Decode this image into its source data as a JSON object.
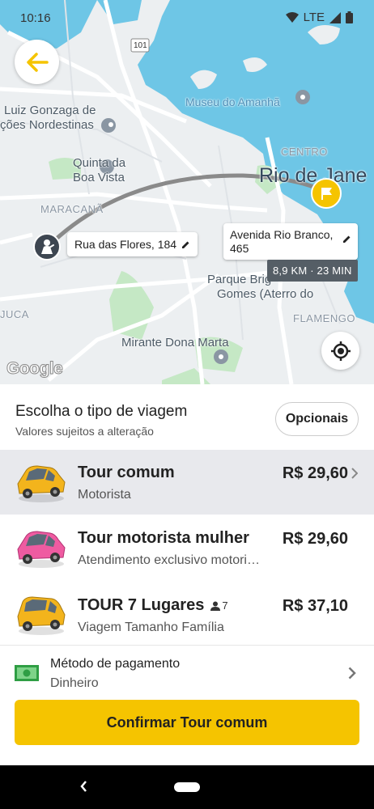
{
  "status_bar": {
    "time": "10:16",
    "network": "LTE"
  },
  "map": {
    "labels": {
      "luiz_gonzaga_1": "Luiz Gonzaga de",
      "luiz_gonzaga_2": "ções Nordestinas",
      "quinta_1": "Quinta da",
      "quinta_2": "Boa Vista",
      "maracana": "MARACANÃ",
      "museu": "Museu do Amanhã",
      "centro": "CENTRO",
      "rio": "Rio de Jane",
      "parque_1": "Parque Brig",
      "parque_2": "Gomes (Aterro do",
      "flamengo": "FLAMENGO",
      "mirante": "Mirante Dona Marta",
      "juca": "JUCA",
      "highway": "101"
    },
    "origin": {
      "address": "Rua das Flores, 184"
    },
    "destination": {
      "address": "Avenida Rio Branco, 465"
    },
    "eta": "8,9 KM · 23 MIN",
    "attribution": "Google"
  },
  "sheet": {
    "title": "Escolha o tipo de viagem",
    "subtitle": "Valores sujeitos a alteração",
    "optionals_label": "Opcionais",
    "rides": [
      {
        "name": "Tour comum",
        "description": "Motorista",
        "price": "R$ 29,60",
        "selected": true,
        "car_color": "#f3b41c"
      },
      {
        "name": "Tour motorista mulher",
        "description": "Atendimento exclusivo motori…",
        "price": "R$ 29,60",
        "selected": false,
        "car_color": "#ef5ba1"
      },
      {
        "name": "TOUR 7 Lugares",
        "seats": "7",
        "description": "Viagem Tamanho Família",
        "price": "R$ 37,10",
        "selected": false,
        "car_color": "#f3b41c"
      }
    ],
    "payment": {
      "label": "Método de pagamento",
      "value": "Dinheiro"
    },
    "confirm_label": "Confirmar Tour comum"
  },
  "colors": {
    "accent": "#f5c400",
    "water": "#6ec6e6",
    "park": "#c5e8c5"
  }
}
